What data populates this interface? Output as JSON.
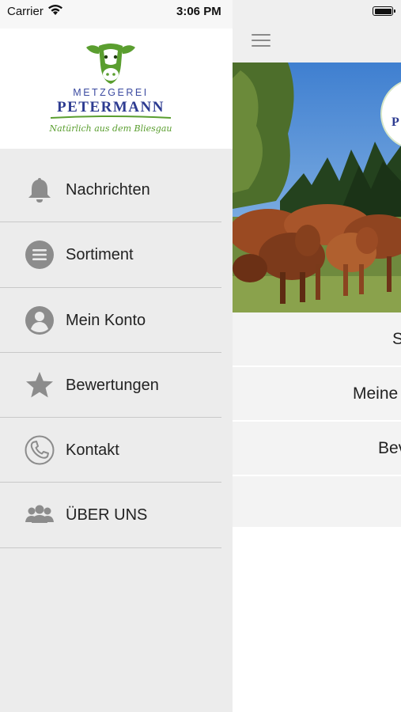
{
  "status_bar": {
    "carrier": "Carrier",
    "time": "3:06 PM"
  },
  "logo": {
    "line1": "METZGEREI",
    "line2": "PETERMANN",
    "tagline": "Natürlich aus dem Bliesgau",
    "colors": {
      "brand_blue": "#2d3b91",
      "brand_green": "#5a9e2f"
    }
  },
  "drawer": {
    "items": [
      {
        "label": "Nachrichten",
        "icon": "bell-icon"
      },
      {
        "label": "Sortiment",
        "icon": "list-circle-icon"
      },
      {
        "label": "Mein Konto",
        "icon": "user-circle-icon"
      },
      {
        "label": "Bewertungen",
        "icon": "star-icon"
      },
      {
        "label": "Kontakt",
        "icon": "phone-icon"
      },
      {
        "label": "ÜBER UNS",
        "icon": "group-icon"
      }
    ]
  },
  "main": {
    "rows": [
      {
        "label": "S"
      },
      {
        "label": "Meine"
      },
      {
        "label": "Bev"
      }
    ]
  },
  "colors": {
    "drawer_bg": "#ececec",
    "divider": "#c9c9c9",
    "icon_gray": "#8c8c8c"
  }
}
